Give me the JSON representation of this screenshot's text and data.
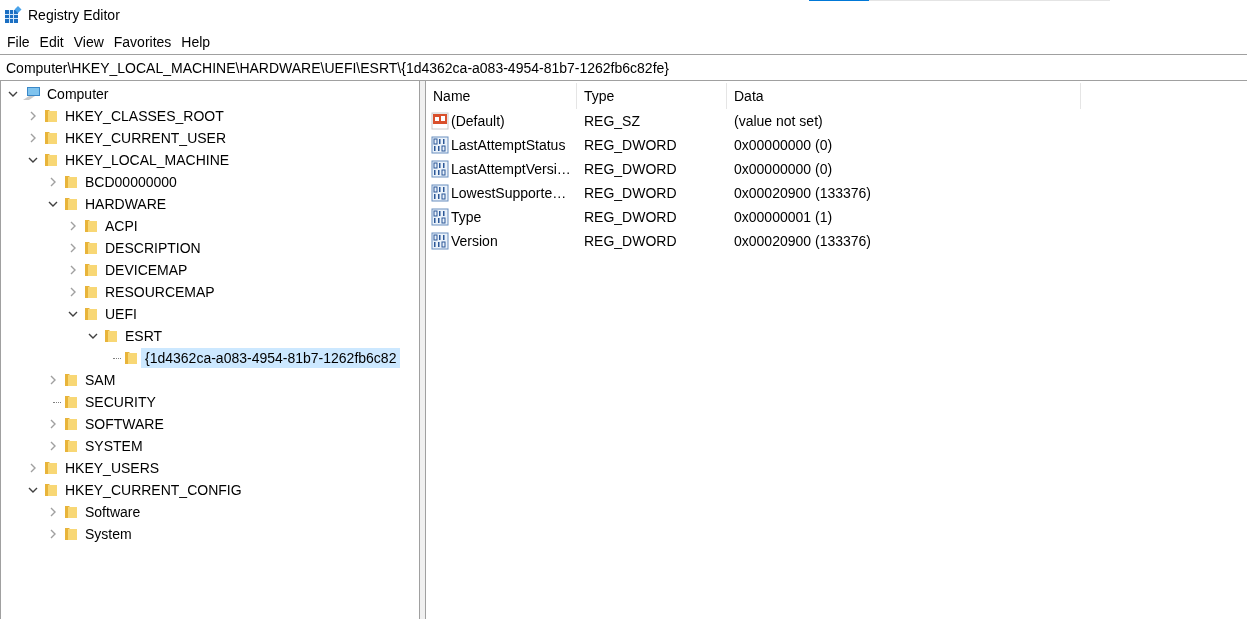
{
  "window": {
    "title": "Registry Editor"
  },
  "top_bar": {
    "level": 0.2
  },
  "menu": [
    "File",
    "Edit",
    "View",
    "Favorites",
    "Help"
  ],
  "address": {
    "value": "Computer\\HKEY_LOCAL_MACHINE\\HARDWARE\\UEFI\\ESRT\\{1d4362ca-a083-4954-81b7-1262fb6c82fe}"
  },
  "tree": {
    "root": {
      "label": "Computer",
      "kind": "computer",
      "expandable": true,
      "expanded": true,
      "selected": false,
      "children": [
        {
          "label": "HKEY_CLASSES_ROOT",
          "kind": "folder",
          "expandable": true,
          "expanded": false,
          "selected": false
        },
        {
          "label": "HKEY_CURRENT_USER",
          "kind": "folder",
          "expandable": true,
          "expanded": false,
          "selected": false
        },
        {
          "label": "HKEY_LOCAL_MACHINE",
          "kind": "folder",
          "expandable": true,
          "expanded": true,
          "selected": false,
          "children": [
            {
              "label": "BCD00000000",
              "kind": "folder",
              "expandable": true,
              "expanded": false,
              "selected": false
            },
            {
              "label": "HARDWARE",
              "kind": "folder",
              "expandable": true,
              "expanded": true,
              "selected": false,
              "children": [
                {
                  "label": "ACPI",
                  "kind": "folder",
                  "expandable": true,
                  "expanded": false,
                  "selected": false
                },
                {
                  "label": "DESCRIPTION",
                  "kind": "folder",
                  "expandable": true,
                  "expanded": false,
                  "selected": false
                },
                {
                  "label": "DEVICEMAP",
                  "kind": "folder",
                  "expandable": true,
                  "expanded": false,
                  "selected": false
                },
                {
                  "label": "RESOURCEMAP",
                  "kind": "folder",
                  "expandable": true,
                  "expanded": false,
                  "selected": false
                },
                {
                  "label": "UEFI",
                  "kind": "folder",
                  "expandable": true,
                  "expanded": true,
                  "selected": false,
                  "children": [
                    {
                      "label": "ESRT",
                      "kind": "folder",
                      "expandable": true,
                      "expanded": true,
                      "selected": false,
                      "children": [
                        {
                          "label": "{1d4362ca-a083-4954-81b7-1262fb6c82",
                          "kind": "folder",
                          "selected": true
                        }
                      ]
                    }
                  ]
                }
              ]
            },
            {
              "label": "SAM",
              "kind": "folder",
              "expandable": true,
              "expanded": false,
              "selected": false
            },
            {
              "label": "SECURITY",
              "kind": "folder",
              "selected": false
            },
            {
              "label": "SOFTWARE",
              "kind": "folder",
              "expandable": true,
              "expanded": false,
              "selected": false
            },
            {
              "label": "SYSTEM",
              "kind": "folder",
              "expandable": true,
              "expanded": false,
              "selected": false
            }
          ]
        },
        {
          "label": "HKEY_USERS",
          "kind": "folder",
          "expandable": true,
          "expanded": false,
          "selected": false
        },
        {
          "label": "HKEY_CURRENT_CONFIG",
          "kind": "folder",
          "expandable": true,
          "expanded": true,
          "selected": false,
          "children": [
            {
              "label": "Software",
              "kind": "folder",
              "expandable": true,
              "expanded": false,
              "selected": false
            },
            {
              "label": "System",
              "kind": "folder",
              "expandable": true,
              "expanded": false,
              "selected": false
            }
          ]
        }
      ]
    }
  },
  "values": {
    "columns": [
      "Name",
      "Type",
      "Data"
    ],
    "rows": [
      {
        "kind": "string",
        "name": "(Default)",
        "type": "REG_SZ",
        "data": "(value not set)"
      },
      {
        "kind": "dword",
        "name": "LastAttemptStatus",
        "type": "REG_DWORD",
        "data": "0x00000000 (0)"
      },
      {
        "kind": "dword",
        "name": "LastAttemptVersi…",
        "type": "REG_DWORD",
        "data": "0x00000000 (0)"
      },
      {
        "kind": "dword",
        "name": "LowestSupporte…",
        "type": "REG_DWORD",
        "data": "0x00020900 (133376)"
      },
      {
        "kind": "dword",
        "name": "Type",
        "type": "REG_DWORD",
        "data": "0x00000001 (1)"
      },
      {
        "kind": "dword",
        "name": "Version",
        "type": "REG_DWORD",
        "data": "0x00020900 (133376)"
      }
    ]
  }
}
